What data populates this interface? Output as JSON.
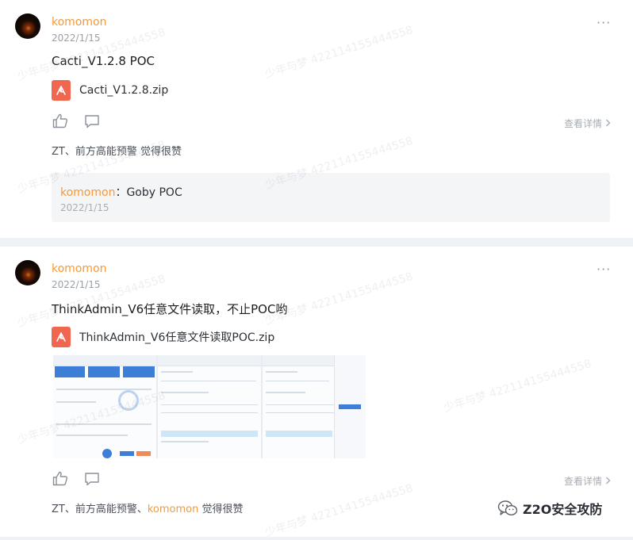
{
  "posts": [
    {
      "author": "komomon",
      "date": "2022/1/15",
      "text": "Cacti_V1.2.8 POC",
      "file": "Cacti_V1.2.8.zip",
      "detail_label": "查看详情",
      "likers_plain": "ZT、前方高能预警",
      "likers_highlight": "",
      "likers_suffix": " 觉得很赞",
      "comment": {
        "author": "komomon",
        "separator": "：",
        "text": "Goby  POC",
        "date": "2022/1/15"
      }
    },
    {
      "author": "komomon",
      "date": "2022/1/15",
      "text": "ThinkAdmin_V6任意文件读取，不止POC哟",
      "file": "ThinkAdmin_V6任意文件读取POC.zip",
      "detail_label": "查看详情",
      "likers_plain": "ZT、前方高能预警、",
      "likers_highlight": "komomon",
      "likers_suffix": " 觉得很赞"
    }
  ],
  "watermark": "少年与梦 422114155444558",
  "brand": {
    "name": "Z2O安全攻防",
    "icon": "wechat-icon"
  },
  "colors": {
    "accent": "#f59a3a",
    "pdf": "#f0664f",
    "tile": "#3d7fd6"
  }
}
